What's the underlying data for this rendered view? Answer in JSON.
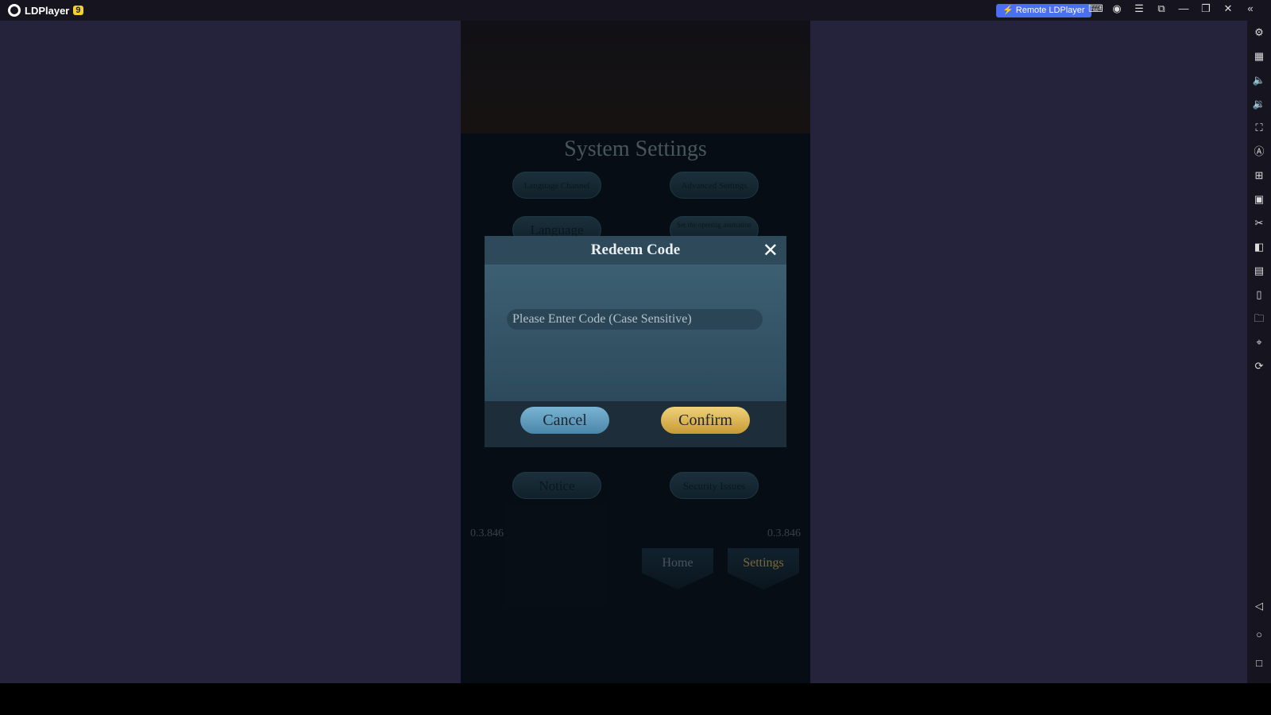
{
  "app": {
    "title": "LDPlayer",
    "version_badge": "9",
    "remote_label": "Remote LDPlayer",
    "titlebar_icons": [
      "gamepad-icon",
      "account-icon",
      "menu-icon",
      "resize-icon",
      "minimize-icon",
      "restore-icon",
      "close-icon",
      "collapse-icon"
    ],
    "sidebar_icons": [
      "settings-icon",
      "keyboard-icon",
      "volume-up-icon",
      "volume-down-icon",
      "screenshot-icon",
      "sync-icon",
      "add-apk-icon",
      "apk-icon",
      "scissors-icon",
      "multi-window-icon",
      "notes-icon",
      "shake-icon",
      "folder-icon",
      "location-icon",
      "rotate-icon"
    ],
    "nav_icons": [
      "back-icon",
      "home-icon",
      "recent-icon"
    ]
  },
  "game": {
    "title": "System Settings",
    "buttons": [
      "Language Channel",
      "Advanced Settings",
      "Language",
      "Set the opening animation",
      "Notice",
      "Security Issues"
    ],
    "version_left": "0.3.846",
    "version_right": "0.3.846",
    "nav": {
      "home": "Home",
      "settings": "Settings"
    },
    "modal": {
      "title": "Redeem Code",
      "placeholder": "Please Enter Code (Case Sensitive)",
      "cancel": "Cancel",
      "confirm": "Confirm"
    }
  }
}
